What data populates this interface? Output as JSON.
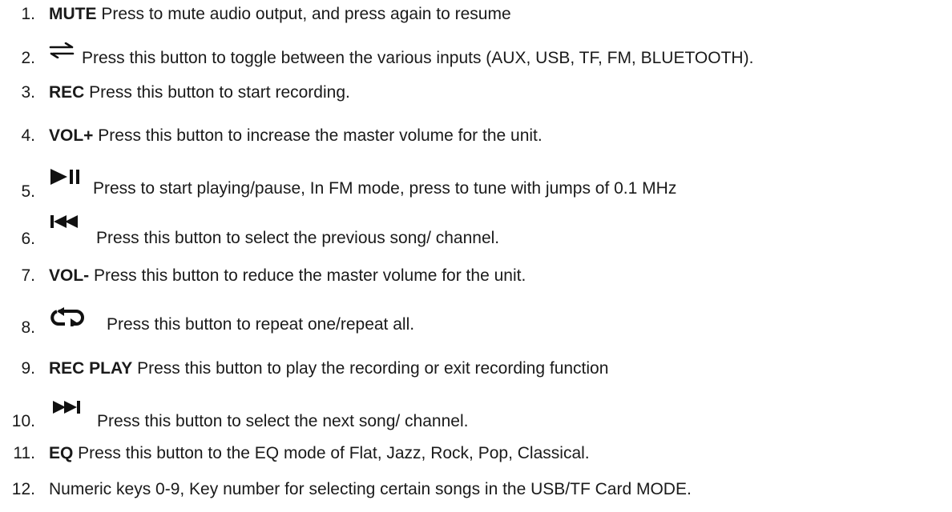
{
  "items": [
    {
      "number": "1.",
      "label": "MUTE",
      "text": " Press to mute audio output, and press again to resume"
    },
    {
      "number": "2.",
      "icon": "input-toggle-arrows-icon",
      "text": "Press this button to toggle between the various inputs (AUX, USB, TF, FM, BLUETOOTH)."
    },
    {
      "number": "3.",
      "label": "REC",
      "text": " Press this button to start recording."
    },
    {
      "number": "4.",
      "label": "VOL+",
      "text": " Press this button to increase the master volume for the unit."
    },
    {
      "number": "5.",
      "icon": "play-pause-icon",
      "text": "Press to start playing/pause, In FM mode, press to tune with jumps of 0.1 MHz"
    },
    {
      "number": "6.",
      "icon": "previous-track-icon",
      "text": "Press this button to select the previous song/ channel."
    },
    {
      "number": "7.",
      "label": "VOL-",
      "text": " Press this button to reduce the master volume for the unit."
    },
    {
      "number": "8.",
      "icon": "repeat-icon",
      "text": "Press this button to repeat one/repeat all."
    },
    {
      "number": "9.",
      "label": "REC PLAY",
      "text": " Press this button to play the recording or exit recording function"
    },
    {
      "number": "10.",
      "icon": "next-track-icon",
      "text": "Press this button to select the next song/ channel."
    },
    {
      "number": "11.",
      "label": "EQ",
      "text": " Press this button to the EQ mode of Flat, Jazz, Rock, Pop, Classical."
    },
    {
      "number": "12.",
      "text": "Numeric keys 0-9, Key number for selecting certain songs in the USB/TF Card MODE."
    }
  ]
}
